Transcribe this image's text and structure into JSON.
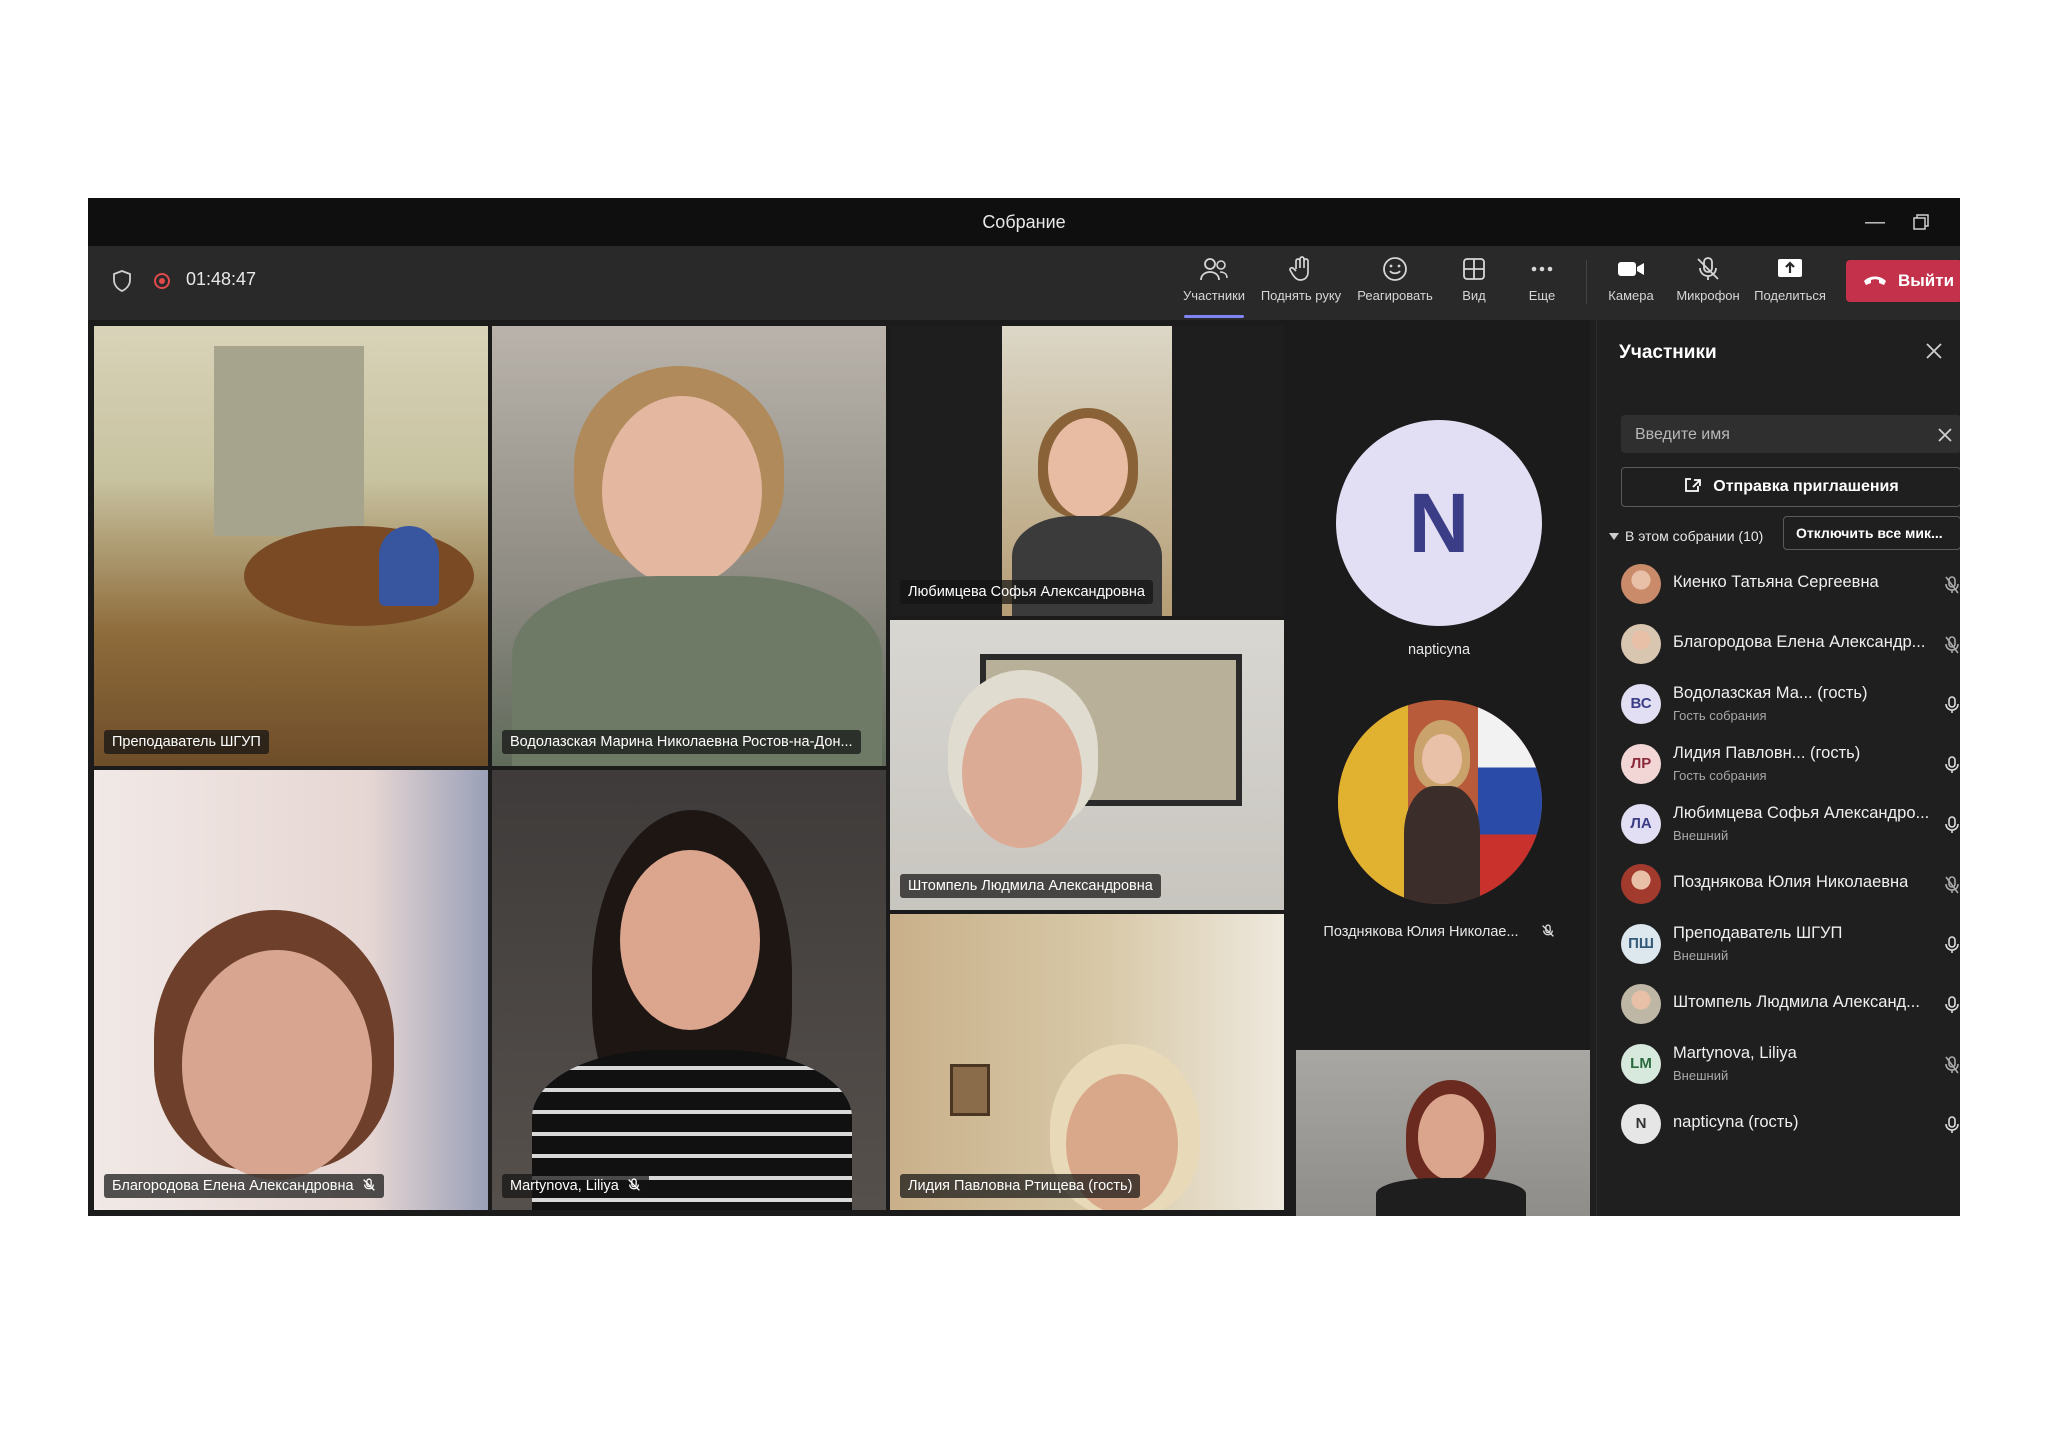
{
  "window": {
    "title": "Собрание"
  },
  "toolbar": {
    "timer": "01:48:47",
    "participants": "Участники",
    "raise_hand": "Поднять руку",
    "react": "Реагировать",
    "view": "Вид",
    "more": "Еще",
    "camera": "Камера",
    "mic": "Микрофон",
    "share": "Поделиться",
    "leave": "Выйти"
  },
  "stage": {
    "tiles": [
      {
        "name": "Преподаватель ШГУП"
      },
      {
        "name": "Водолазская Марина Николаевна Ростов-на-Дон..."
      },
      {
        "name": "Любимцева Софья Александровна"
      },
      {
        "name": "Благородова Елена Александровна"
      },
      {
        "name": "Martynova, Liliya"
      },
      {
        "name": "Штомпель Людмила Александровна"
      },
      {
        "name": "Лидия Павловна Ртищева (гость)"
      }
    ],
    "avatar_initial": "N",
    "avatar_name": "napticyna",
    "avatar2_name": "Позднякова Юлия Николае..."
  },
  "panel": {
    "title": "Участники",
    "search_placeholder": "Введите имя",
    "invite": "Отправка приглашения",
    "section": "В этом собрании (10)",
    "mute_all": "Отключить все мик...",
    "participants": [
      {
        "name": "Киенко Татьяна Сергеевна",
        "sub": "",
        "initials": "",
        "muted": true
      },
      {
        "name": "Благородова Елена Александр...",
        "sub": "",
        "initials": "",
        "muted": true
      },
      {
        "name": "Водолазская Ма... (гость)",
        "sub": "Гость собрания",
        "initials": "ВС",
        "muted": false
      },
      {
        "name": "Лидия Павловн... (гость)",
        "sub": "Гость собрания",
        "initials": "ЛР",
        "muted": false
      },
      {
        "name": "Любимцева Софья Александро...",
        "sub": "Внешний",
        "initials": "ЛА",
        "muted": false
      },
      {
        "name": "Позднякова Юлия Николаевна",
        "sub": "",
        "initials": "",
        "muted": true
      },
      {
        "name": "Преподаватель ШГУП",
        "sub": "Внешний",
        "initials": "ПШ",
        "muted": false
      },
      {
        "name": "Штомпель Людмила Александ...",
        "sub": "",
        "initials": "",
        "muted": false
      },
      {
        "name": "Martynova, Liliya",
        "sub": "Внешний",
        "initials": "LM",
        "muted": true
      },
      {
        "name": "napticyna (гость)",
        "sub": "",
        "initials": "N",
        "muted": false
      }
    ]
  },
  "colors": {
    "accent": "#7f85f5",
    "leave": "#c4314b",
    "record": "#e04a4a"
  }
}
